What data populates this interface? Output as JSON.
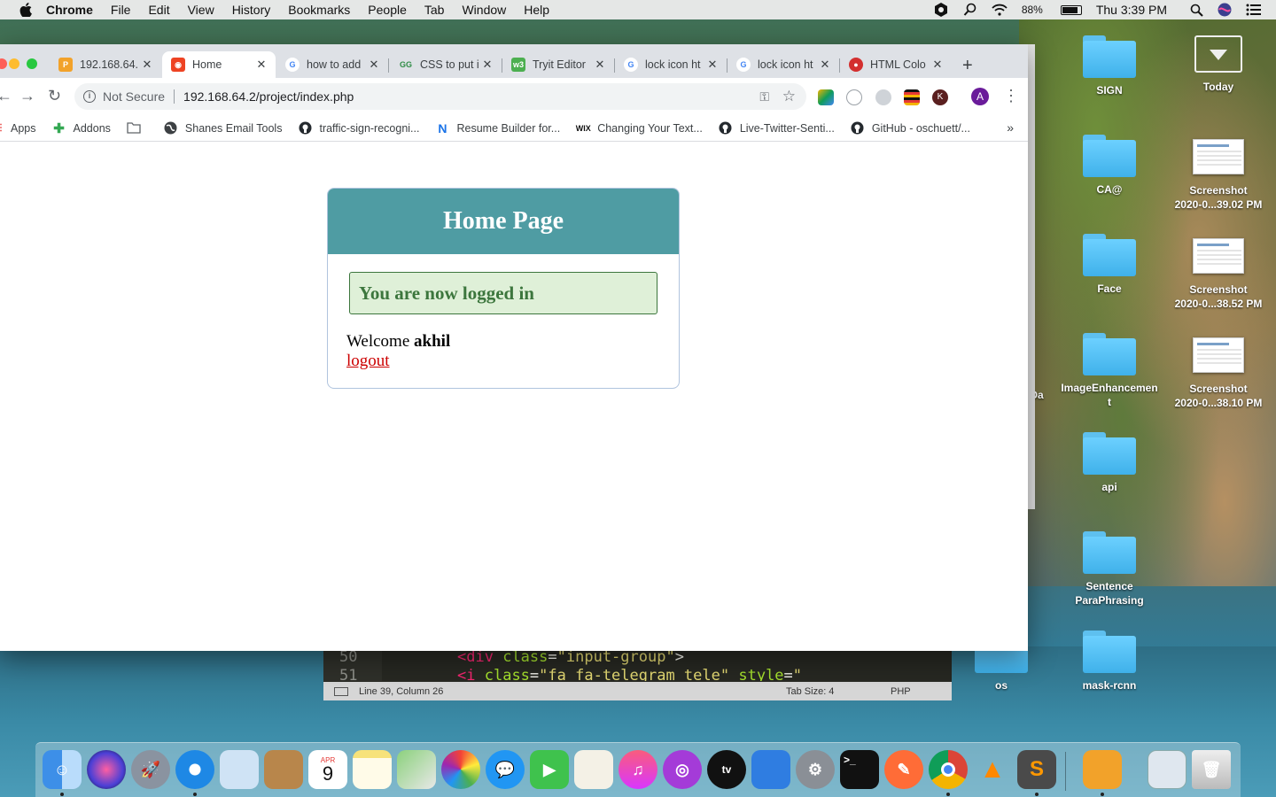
{
  "menubar": {
    "app": "Chrome",
    "menus": [
      "File",
      "Edit",
      "View",
      "History",
      "Bookmarks",
      "People",
      "Tab",
      "Window",
      "Help"
    ],
    "battery": "88%",
    "battery_level": 0.88,
    "clock": "Thu 3:39 PM"
  },
  "tabs": [
    {
      "title": "192.168.64.",
      "favicon": "phpmyadmin-icon",
      "active": false
    },
    {
      "title": "Home",
      "favicon": "codeigniter-icon",
      "active": true
    },
    {
      "title": "how to add",
      "favicon": "google-icon",
      "active": false
    },
    {
      "title": "CSS to put i",
      "favicon": "geeksforgeeks-icon",
      "active": false
    },
    {
      "title": "Tryit Editor",
      "favicon": "w3schools-icon",
      "active": false
    },
    {
      "title": "lock icon ht",
      "favicon": "google-icon",
      "active": false
    },
    {
      "title": "lock icon ht",
      "favicon": "google-icon",
      "active": false
    },
    {
      "title": "HTML Colo",
      "favicon": "html-color-icon",
      "active": false
    }
  ],
  "omnibox": {
    "security": "Not Secure",
    "url": "192.168.64.2/project/index.php"
  },
  "profile_initial": "A",
  "bookmarks": [
    {
      "label": "Apps",
      "icon": "apps-grid-icon"
    },
    {
      "label": "Addons",
      "icon": "puzzle-icon"
    },
    {
      "label": "",
      "icon": "folder-icon"
    },
    {
      "label": "Shanes Email Tools",
      "icon": "globe-icon"
    },
    {
      "label": "traffic-sign-recogni...",
      "icon": "github-icon"
    },
    {
      "label": "Resume Builder for...",
      "icon": "n-logo-icon"
    },
    {
      "label": "Changing Your Text...",
      "icon": "wix-icon"
    },
    {
      "label": "Live-Twitter-Senti...",
      "icon": "github-icon"
    },
    {
      "label": "GitHub - oschuett/...",
      "icon": "github-icon"
    }
  ],
  "page": {
    "header_title": "Home Page",
    "success_message": "You are now logged in",
    "welcome_prefix": "Welcome",
    "username": "akhil",
    "logout_label": "logout"
  },
  "editor": {
    "lines": [
      {
        "num": "50",
        "text": "<div class=\"input-group\">"
      },
      {
        "num": "51",
        "text": "<i class=\"fa fa-telegram tele\" style=\""
      }
    ],
    "status_position": "Line 39, Column 26",
    "status_tab": "Tab Size: 4",
    "status_syntax": "PHP"
  },
  "desktop_icons": [
    {
      "label": "SIGN",
      "kind": "folder"
    },
    {
      "label": "Today",
      "kind": "download-folder"
    },
    {
      "label": "CA@",
      "kind": "folder"
    },
    {
      "label": "Screenshot\n2020-0...39.02 PM",
      "kind": "screenshot"
    },
    {
      "label": "Face",
      "kind": "folder"
    },
    {
      "label": "Screenshot\n2020-0...38.52 PM",
      "kind": "screenshot"
    },
    {
      "label": "ImageEnhancemen\nt",
      "kind": "folder"
    },
    {
      "label": "Screenshot\n2020-0...38.10 PM",
      "kind": "screenshot"
    },
    {
      "label": "api",
      "kind": "folder"
    },
    {
      "label": "Sentence\nParaPhrasing",
      "kind": "folder"
    },
    {
      "label": "mask-rcnn",
      "kind": "folder"
    },
    {
      "label": "os",
      "kind": "folder"
    },
    {
      "label": "Da",
      "kind": "folder"
    }
  ],
  "dock": {
    "calendar_month": "APR",
    "calendar_day": "9",
    "apps": [
      "finder-icon",
      "siri-icon",
      "launchpad-icon",
      "safari-icon",
      "preview-icon",
      "contacts-icon",
      "calendar-icon",
      "notes-icon",
      "maps-icon",
      "photos-icon",
      "messages-icon",
      "facetime-icon",
      "textedit-icon",
      "music-icon",
      "podcasts-icon",
      "apple-tv-icon",
      "keynote-icon",
      "system-preferences-icon",
      "terminal-icon",
      "postman-icon",
      "chrome-icon",
      "vlc-icon",
      "sublime-text-icon",
      "xampp-icon",
      "screenshot-app-icon",
      "trash-icon"
    ]
  },
  "colors": {
    "header_teal": "#4f9ca3",
    "success_green": "#3c763d",
    "success_bg": "#dff0d8",
    "logout_red": "#cc0000"
  }
}
